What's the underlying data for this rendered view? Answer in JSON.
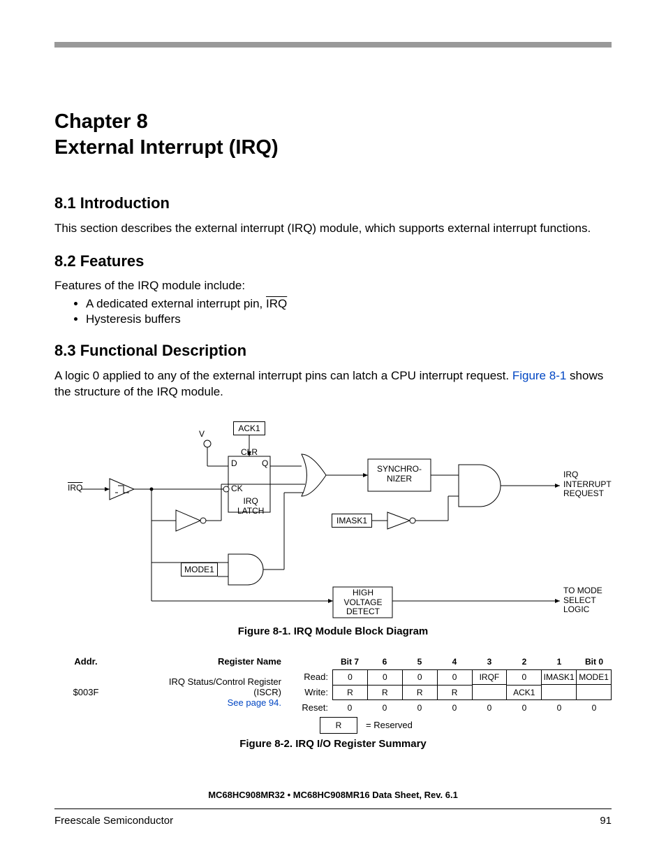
{
  "chapter": {
    "line1": "Chapter 8",
    "line2": "External Interrupt (IRQ)"
  },
  "s81": {
    "heading": "8.1  Introduction",
    "text": "This section describes the external interrupt (IRQ) module, which supports external interrupt functions."
  },
  "s82": {
    "heading": "8.2  Features",
    "intro": "Features of the IRQ module include:",
    "items": {
      "a_pre": "A dedicated external interrupt pin, ",
      "a_sig": "IRQ",
      "b": "Hysteresis buffers"
    }
  },
  "s83": {
    "heading": "8.3  Functional Description",
    "text_pre": "A logic 0 applied to any of the external interrupt pins can latch a CPU interrupt request. ",
    "link": "Figure 8-1",
    "text_post": " shows the structure of the IRQ module."
  },
  "diagram": {
    "irq_pin": "IRQ",
    "vdd": "V",
    "ack1": "ACK1",
    "clr": "CLR",
    "d": "D",
    "q": "Q",
    "ck": "CK",
    "latch": "IRQ\nLATCH",
    "sync": "SYNCHRO-\nNIZER",
    "imask1": "IMASK1",
    "mode1": "MODE1",
    "hvd": "HIGH\nVOLTAGE\nDETECT",
    "out": "IRQ\nINTERRUPT\nREQUEST",
    "tomode": "TO MODE\nSELECT\nLOGIC"
  },
  "fig81_caption": "Figure 8-1. IRQ Module Block Diagram",
  "register": {
    "headers": {
      "addr": "Addr.",
      "name": "Register Name",
      "bits": [
        "Bit 7",
        "6",
        "5",
        "4",
        "3",
        "2",
        "1",
        "Bit 0"
      ]
    },
    "addr": "$003F",
    "name_l1": "IRQ Status/Control Register",
    "name_l2": "(ISCR)",
    "seepage": "See page 94.",
    "rows": {
      "read": {
        "label": "Read:",
        "cells": [
          "0",
          "0",
          "0",
          "0",
          "IRQF",
          "0",
          "IMASK1",
          "MODE1"
        ]
      },
      "write": {
        "label": "Write:",
        "cells": [
          "R",
          "R",
          "R",
          "R",
          "",
          "ACK1",
          "",
          ""
        ]
      },
      "reset": {
        "label": "Reset:",
        "cells": [
          "0",
          "0",
          "0",
          "0",
          "0",
          "0",
          "0",
          "0"
        ]
      }
    },
    "legend_r": "R",
    "legend_txt": "= Reserved"
  },
  "fig82_caption": "Figure 8-2. IRQ I/O Register Summary",
  "footer": {
    "doc": "MC68HC908MR32 • MC68HC908MR16 Data Sheet, Rev. 6.1",
    "vendor": "Freescale Semiconductor",
    "page": "91"
  }
}
